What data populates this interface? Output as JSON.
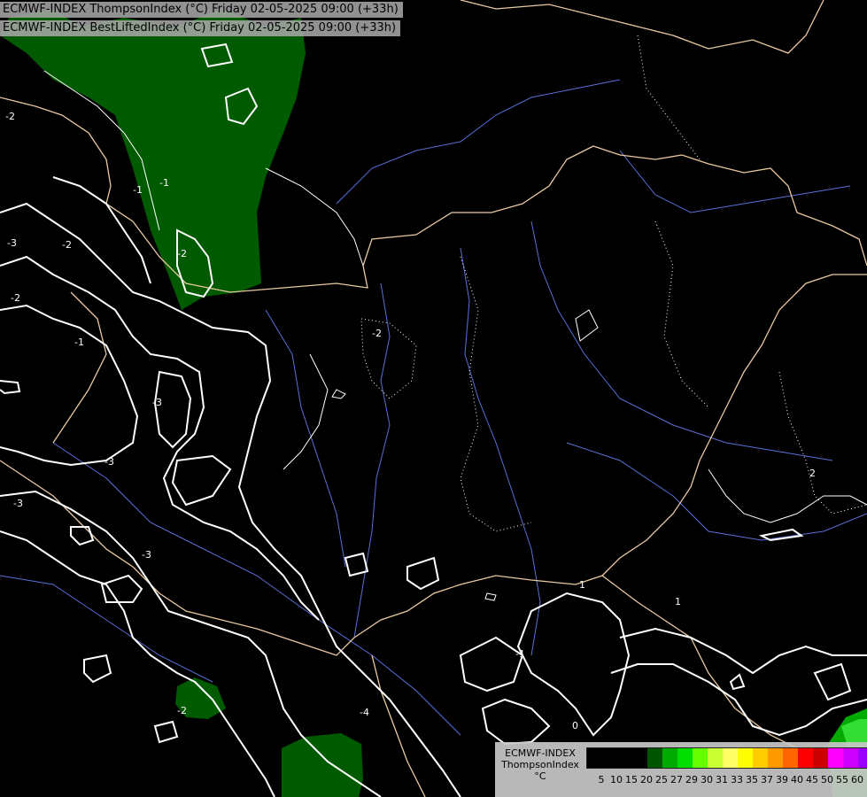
{
  "header": {
    "line1": "ECMWF-INDEX ThompsonIndex (°C) Friday 02-05-2025 09:00 (+33h)",
    "line2": "ECMWF-INDEX BestLiftedIndex (°C) Friday 02-05-2025 09:00 (+33h)"
  },
  "legend": {
    "title_line1": "ECMWF-INDEX",
    "title_line2": "ThompsonIndex",
    "unit": "°C",
    "swatches": [
      "#000000",
      "#000000",
      "#000000",
      "#000000",
      "#005500",
      "#00aa00",
      "#00dd00",
      "#66ff00",
      "#ccff33",
      "#ffff66",
      "#ffff00",
      "#ffcc00",
      "#ff9900",
      "#ff6600",
      "#ff0000",
      "#cc0000",
      "#ff00ff",
      "#cc00ff",
      "#9900ff",
      "#5500ff",
      "#0000ff"
    ],
    "ticks": [
      "5",
      "10",
      "15",
      "20",
      "25",
      "27",
      "29",
      "30",
      "31",
      "33",
      "35",
      "37",
      "39",
      "40",
      "45",
      "50",
      "55",
      "60"
    ]
  },
  "contour_labels": [
    "-2",
    "-2",
    "-3",
    "-2",
    "-2",
    "-1",
    "-3",
    "-3",
    "-3",
    "-3",
    "-2",
    "-4",
    "-2",
    "-1",
    "1",
    "-1",
    "0",
    "2",
    "-1",
    "1"
  ],
  "colors": {
    "thompson_green": "#005a00",
    "contour": "#ffffff",
    "border": "#e8c9a0",
    "river": "#5a6fd8"
  }
}
